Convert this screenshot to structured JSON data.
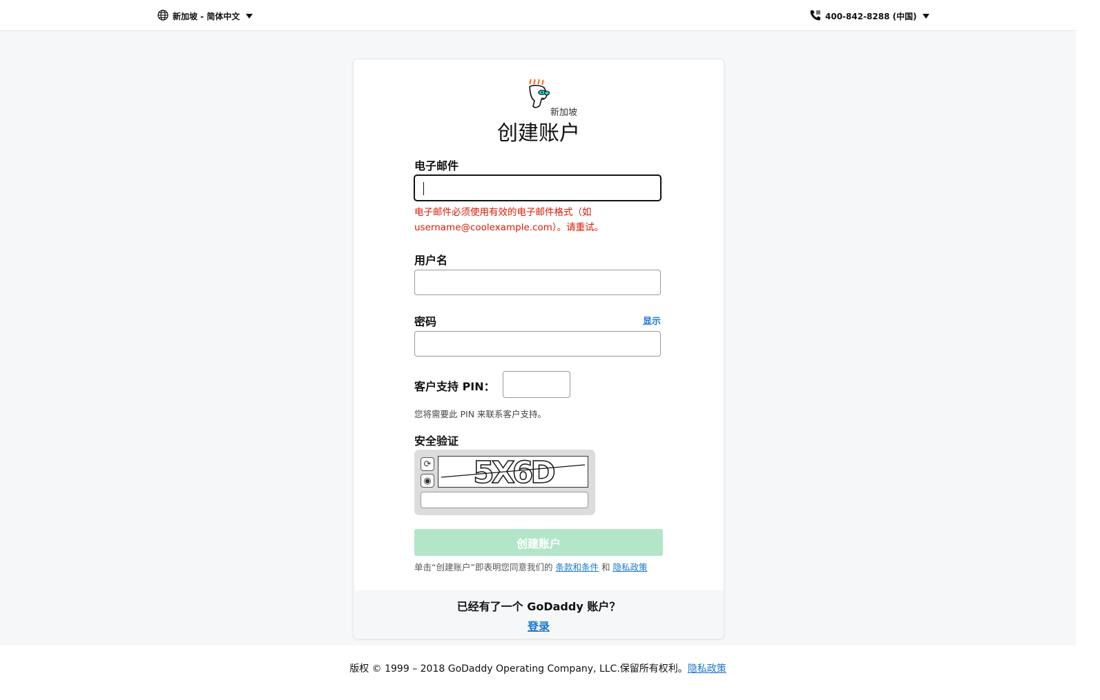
{
  "header": {
    "locale": "新加坡 - 简体中文",
    "phone": "400-842-8288 (中国)"
  },
  "brand": {
    "region": "新加坡",
    "logo_icon": "godaddy-guy-logo",
    "success_color": "#b3e5c9",
    "error_color": "#db1802",
    "link_color": "#1976d2"
  },
  "form": {
    "title": "创建账户",
    "email": {
      "label": "电子邮件",
      "value": "",
      "error": "电子邮件必须使用有效的电子邮件格式（如 username@coolexample.com）。请重试。"
    },
    "username": {
      "label": "用户名",
      "value": ""
    },
    "password": {
      "label": "密码",
      "show_label": "显示",
      "value": ""
    },
    "pin": {
      "label": "客户支持 PIN：",
      "help": "您将需要此 PIN 来联系客户支持。",
      "value": ""
    },
    "captcha": {
      "label": "安全验证",
      "image_text": "5X6D",
      "value": ""
    },
    "submit_label": "创建账户",
    "terms": {
      "prefix": "单击“创建账户”即表明您同意我们的",
      "terms_link": "条款和条件",
      "and": "和",
      "privacy_link": "隐私政策"
    }
  },
  "signin": {
    "question": "已经有了一个 GoDaddy 账户？",
    "link": "登录"
  },
  "footer": {
    "copyright": "版权 © 1999 – 2018 GoDaddy Operating Company, LLC.保留所有权利。",
    "privacy_link": "隐私政策"
  }
}
